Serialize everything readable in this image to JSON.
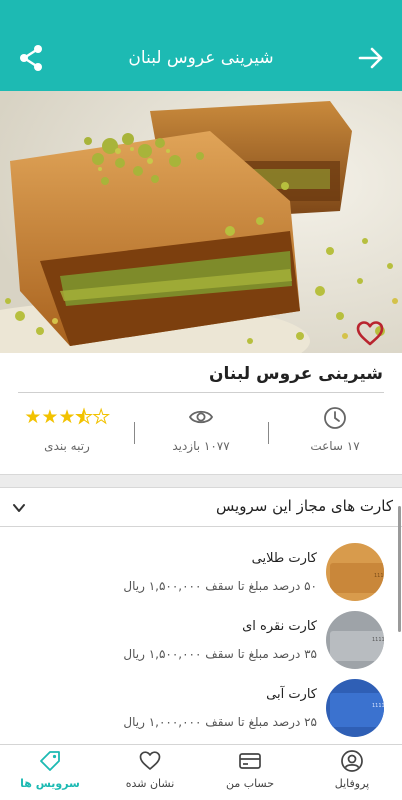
{
  "header": {
    "title": "شیرینی عروس لبنان",
    "share_icon": "share-icon",
    "back_icon": "arrow-right-icon",
    "color": "#1dbab3"
  },
  "product": {
    "name": "شیرینی عروس لبنان",
    "favorite_icon": "heart-outline-icon",
    "stats": {
      "time": "۱۷ ساعت",
      "views": "۱۰۷۷ بازدید",
      "rating_label": "رتبه بندی",
      "rating_value": 3.5,
      "rating_max": 5
    }
  },
  "cards_section": {
    "title": "کارت های مجاز این سرویس",
    "items": [
      {
        "name": "کارت طلایی",
        "desc": "۵۰ درصد مبلغ تا سقف ۱,۵۰۰,۰۰۰ ریال",
        "color": "#d89b4c"
      },
      {
        "name": "کارت نقره ای",
        "desc": "۳۵ درصد مبلغ تا سقف ۱,۵۰۰,۰۰۰ ریال",
        "color": "#9ea3a8"
      },
      {
        "name": "کارت آبی",
        "desc": "۲۵ درصد مبلغ تا سقف ۱,۰۰۰,۰۰۰ ریال",
        "color": "#2f5fb5"
      }
    ]
  },
  "bottom_nav": {
    "items": [
      {
        "label": "سرویس ها",
        "icon": "tag-icon",
        "active": true
      },
      {
        "label": "نشان شده",
        "icon": "heart-icon",
        "active": false
      },
      {
        "label": "حساب من",
        "icon": "credit-card-icon",
        "active": false
      },
      {
        "label": "پروفایل",
        "icon": "user-icon",
        "active": false
      }
    ]
  }
}
